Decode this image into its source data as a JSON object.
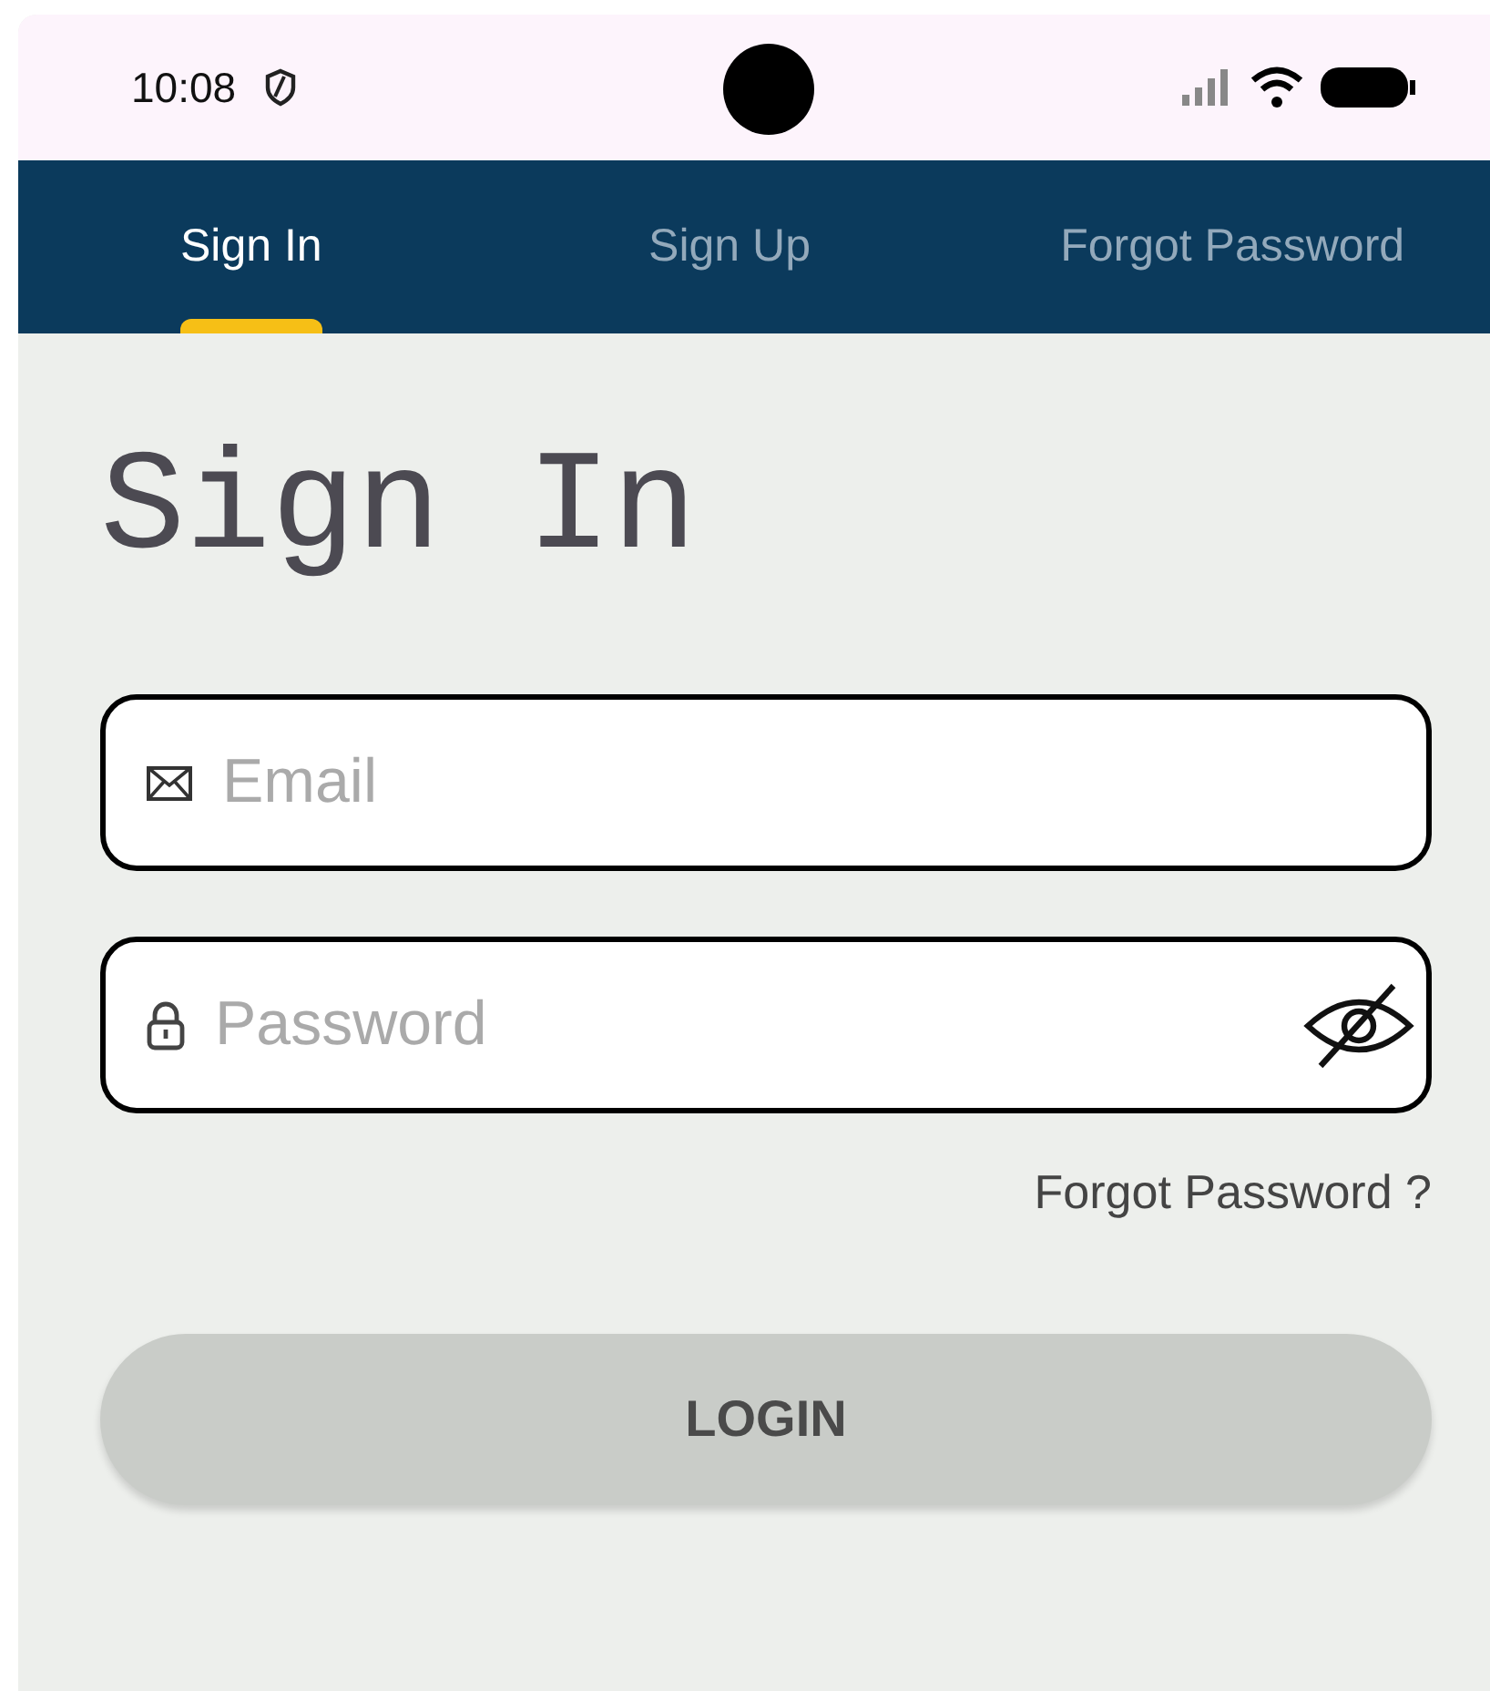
{
  "status_bar": {
    "time": "10:08"
  },
  "tabs": [
    {
      "label": "Sign In",
      "selected": true
    },
    {
      "label": "Sign Up",
      "selected": false
    },
    {
      "label": "Forgot Password",
      "selected": false
    }
  ],
  "title": "Sign In",
  "email": {
    "placeholder": "Email"
  },
  "password": {
    "placeholder": "Password"
  },
  "forgot_link": "Forgot Password ?",
  "login_button": {
    "label": "LOGIN",
    "disabled": true
  }
}
